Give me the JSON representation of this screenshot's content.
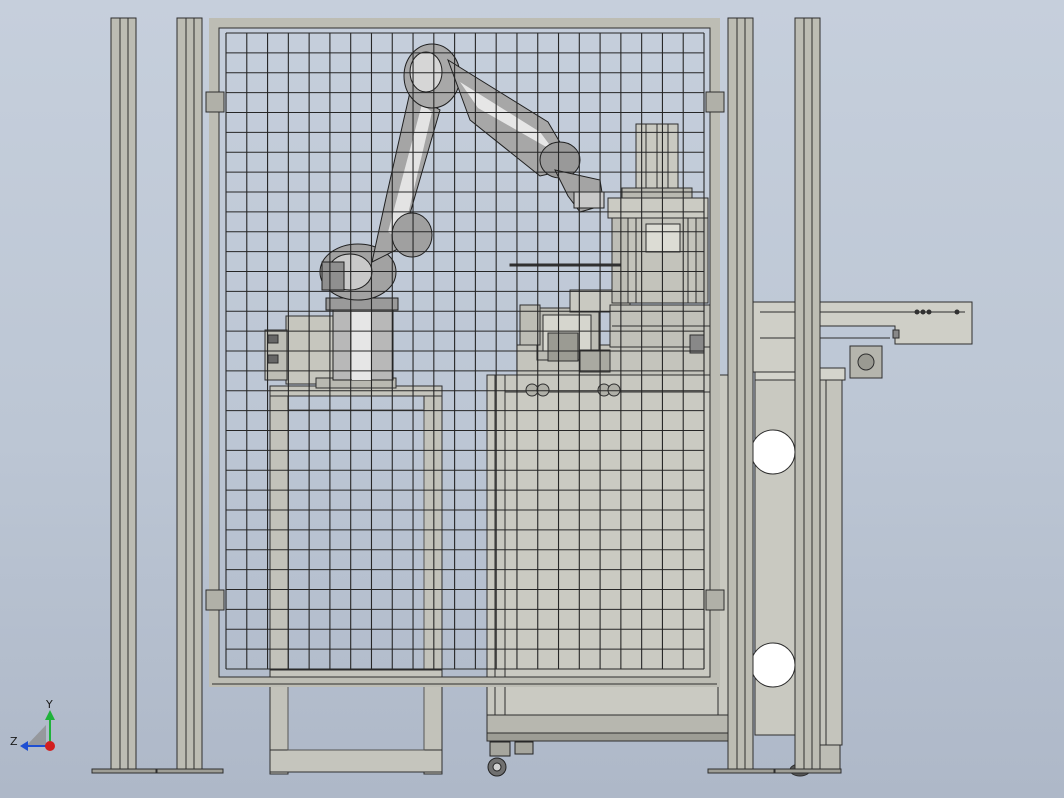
{
  "viewport": {
    "background_top": "#c6cfdc",
    "background_bottom": "#aeb8c8"
  },
  "colors": {
    "frame_fill": "#b9b9b0",
    "frame_edge": "#2e2e2e",
    "grid_line": "#262626",
    "robot_fill": "#9c9c9c",
    "robot_highlight": "#e8e8e8",
    "machine_fill": "#c8c8c0",
    "axis_x": "#d21f1f",
    "axis_y": "#1fb23a",
    "axis_z": "#1f4fd2"
  },
  "triad": {
    "y_label": "Y",
    "z_label": "Z",
    "icon": "coordinate-triad-icon"
  },
  "fence": {
    "grid_columns": 23,
    "grid_rows": 32,
    "hinge_count": 4
  }
}
